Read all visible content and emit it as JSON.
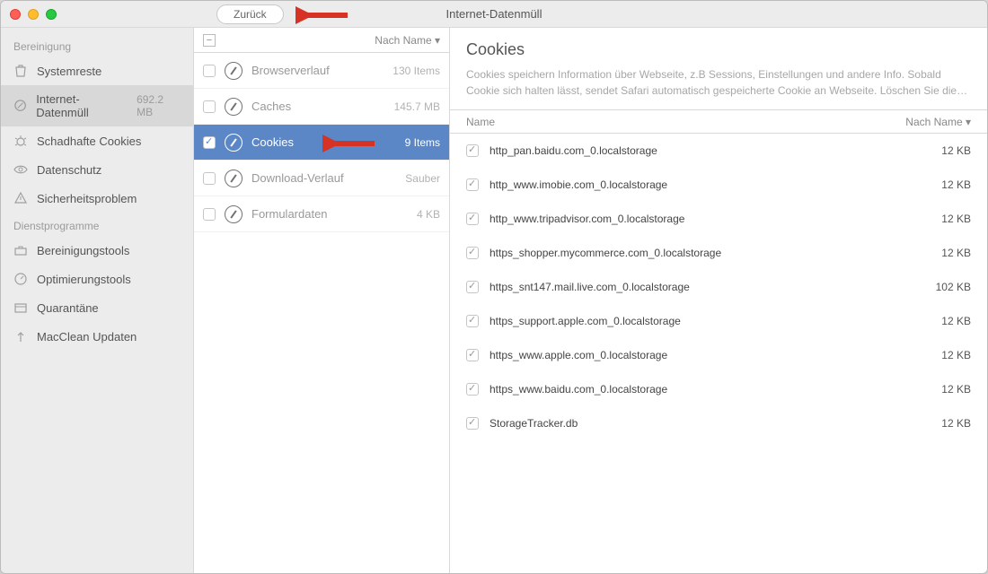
{
  "window_title": "Internet-Datenmüll",
  "back_label": "Zurück",
  "sidebar": {
    "sections": [
      {
        "title": "Bereinigung",
        "items": [
          {
            "icon": "trash",
            "label": "Systemreste",
            "size": ""
          },
          {
            "icon": "safari",
            "label": "Internet-Datenmüll",
            "size": "692.2 MB",
            "selected": true
          },
          {
            "icon": "bug",
            "label": "Schadhafte Cookies",
            "size": ""
          },
          {
            "icon": "eye",
            "label": "Datenschutz",
            "size": ""
          },
          {
            "icon": "warn",
            "label": "Sicherheitsproblem",
            "size": ""
          }
        ]
      },
      {
        "title": "Dienstprogramme",
        "items": [
          {
            "icon": "toolbox",
            "label": "Bereinigungstools",
            "size": ""
          },
          {
            "icon": "gauge",
            "label": "Optimierungstools",
            "size": ""
          },
          {
            "icon": "box",
            "label": "Quarantäne",
            "size": ""
          },
          {
            "icon": "update",
            "label": "MacClean Updaten",
            "size": ""
          }
        ]
      }
    ]
  },
  "mid": {
    "sort_label": "Nach Name ▾",
    "items": [
      {
        "label": "Browserverlauf",
        "meta": "130 Items"
      },
      {
        "label": "Caches",
        "meta": "145.7 MB"
      },
      {
        "label": "Cookies",
        "meta": "9 Items",
        "selected": true,
        "checked": true
      },
      {
        "label": "Download-Verlauf",
        "meta": "Sauber"
      },
      {
        "label": "Formulardaten",
        "meta": "4 KB"
      }
    ]
  },
  "detail": {
    "title": "Cookies",
    "desc": "Cookies speichern Information über Webseite, z.B Sessions, Einstellungen und andere Info. Sobald Cookie sich halten lässt, sendet Safari automatisch gespeicherte Cookie an Webseite. Löschen Sie die…",
    "col_name": "Name",
    "col_sort": "Nach Name ▾",
    "rows": [
      {
        "name": "http_pan.baidu.com_0.localstorage",
        "size": "12 KB"
      },
      {
        "name": "http_www.imobie.com_0.localstorage",
        "size": "12 KB"
      },
      {
        "name": "http_www.tripadvisor.com_0.localstorage",
        "size": "12 KB"
      },
      {
        "name": "https_shopper.mycommerce.com_0.localstorage",
        "size": "12 KB"
      },
      {
        "name": "https_snt147.mail.live.com_0.localstorage",
        "size": "102 KB"
      },
      {
        "name": "https_support.apple.com_0.localstorage",
        "size": "12 KB"
      },
      {
        "name": "https_www.apple.com_0.localstorage",
        "size": "12 KB"
      },
      {
        "name": "https_www.baidu.com_0.localstorage",
        "size": "12 KB"
      },
      {
        "name": "StorageTracker.db",
        "size": "12 KB"
      }
    ]
  }
}
